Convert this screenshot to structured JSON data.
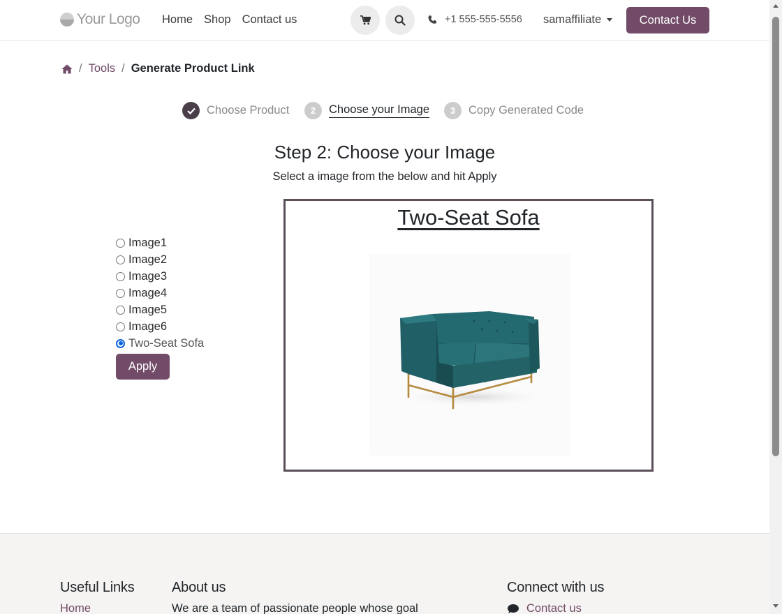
{
  "header": {
    "logo": "Your Logo",
    "nav": [
      "Home",
      "Shop",
      "Contact us"
    ],
    "cart_icon": "cart-icon",
    "search_icon": "search-icon",
    "phone": "+1 555-555-5556",
    "user": "samaffiliate",
    "cta": "Contact Us"
  },
  "breadcrumb": {
    "home_icon": "home-icon",
    "items": [
      "Tools",
      "Generate Product Link"
    ]
  },
  "steps": [
    {
      "marker": "",
      "label": "Choose Product",
      "state": "done"
    },
    {
      "marker": "2",
      "label": "Choose your Image",
      "state": "active"
    },
    {
      "marker": "3",
      "label": "Copy Generated Code",
      "state": "pending"
    }
  ],
  "main": {
    "title": "Step 2: Choose your Image",
    "subtitle": "Select a image from the below and hit Apply",
    "options": [
      "Image1",
      "Image2",
      "Image3",
      "Image4",
      "Image5",
      "Image6",
      "Two-Seat Sofa"
    ],
    "selected_option": "Two-Seat Sofa",
    "apply_label": "Apply",
    "preview_title": "Two-Seat Sofa"
  },
  "footer": {
    "useful_links": {
      "heading": "Useful Links",
      "items": [
        "Home"
      ]
    },
    "about": {
      "heading": "About us",
      "text": "We are a team of passionate people whose goal"
    },
    "connect": {
      "heading": "Connect with us",
      "items": [
        "Contact us"
      ]
    }
  },
  "colors": {
    "primary": "#714b67",
    "step_done": "#4a3f48",
    "step_pending": "#cccccc",
    "radio_checked": "#0b62e0"
  }
}
